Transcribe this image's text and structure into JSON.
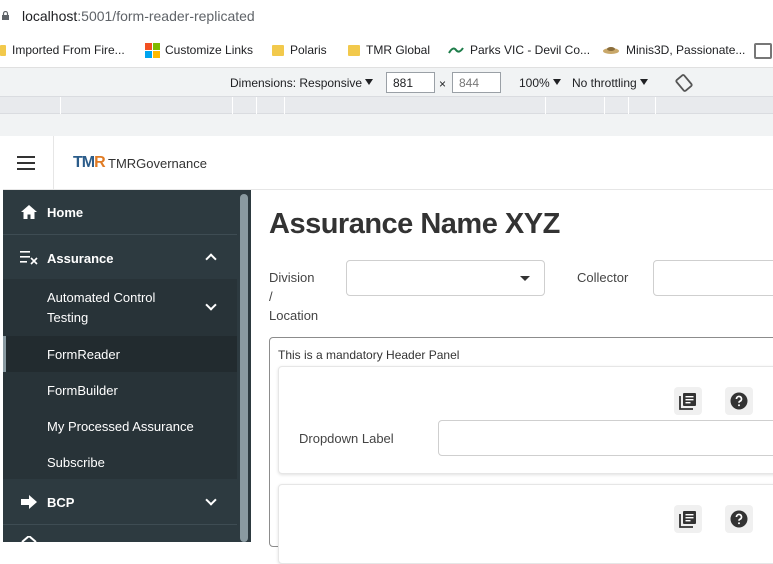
{
  "browser": {
    "url_host": "localhost",
    "url_rest": ":5001/form-reader-replicated",
    "bookmarks": [
      {
        "label": "Imported From Fire...",
        "icon": "folder-icon"
      },
      {
        "label": "Customize Links",
        "icon": "microsoft-logo-icon"
      },
      {
        "label": "Polaris",
        "icon": "folder-icon"
      },
      {
        "label": "TMR Global",
        "icon": "folder-icon"
      },
      {
        "label": "Parks VIC - Devil Co...",
        "icon": "parks-vic-icon"
      },
      {
        "label": "Minis3D, Passionate...",
        "icon": "minis3d-icon"
      }
    ],
    "devtools": {
      "dimensions_label": "Dimensions: Responsive",
      "width": "881",
      "height": "844",
      "times": "×",
      "zoom": "100%",
      "throttling": "No throttling"
    }
  },
  "app": {
    "logo_text": {
      "t": "T",
      "m": "M",
      "r": "R"
    },
    "brand": "TMRGovernance"
  },
  "sidebar": {
    "home": "Home",
    "assurance": "Assurance",
    "sub": {
      "automated_line1": "Automated Control",
      "automated_line2": "Testing",
      "formreader": "FormReader",
      "formbuilder": "FormBuilder",
      "processed": "My Processed Assurance",
      "subscribe": "Subscribe"
    },
    "bcp": "BCP"
  },
  "main": {
    "title": "Assurance Name XYZ",
    "division_label_1": "Division",
    "division_label_2": "/",
    "division_label_3": "Location",
    "division_value": "",
    "collector_label": "Collector",
    "collector_value": "",
    "panel_title": "This is a mandatory Header Panel",
    "card1": {
      "dropdown_label": "Dropdown Label",
      "value": ""
    }
  }
}
